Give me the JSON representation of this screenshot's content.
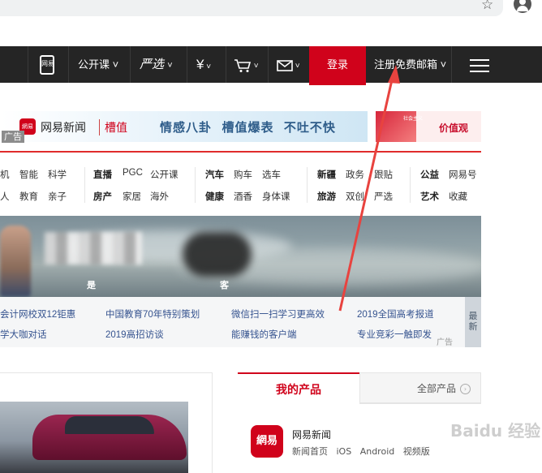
{
  "browser": {
    "star_icon": "star-icon",
    "profile_icon": "account-circle-icon"
  },
  "nav": {
    "items": [
      {
        "label": "",
        "icon": "phone-icon",
        "sub": "网易"
      },
      {
        "label": "公开课"
      },
      {
        "label": "严选"
      },
      {
        "label": "¥"
      },
      {
        "label": "cart"
      },
      {
        "label": "mail"
      }
    ],
    "login": "登录",
    "register": "注册免费邮箱",
    "menu_icon": "hamburger-icon"
  },
  "banner": {
    "logo_text": "网易新闻",
    "brand_tag": "槽值",
    "slogan": "情感八卦  槽值爆表  不吐不快",
    "ad_label": "广告",
    "right_small": "社会主义",
    "right_text": "价值观"
  },
  "nav_links": {
    "row1": [
      "机",
      "智能",
      "科学",
      "直播",
      "PGC",
      "公开课",
      "汽车",
      "购车",
      "选车",
      "新疆",
      "政务",
      "跟贴",
      "公益",
      "网易号"
    ],
    "row2": [
      "人",
      "教育",
      "亲子",
      "房产",
      "家居",
      "海外",
      "健康",
      "酒香",
      "身体课",
      "旅游",
      "双创",
      "严选",
      "艺术",
      "收藏"
    ]
  },
  "hero": {
    "caption_a": "是",
    "caption_b": "客"
  },
  "headline_links": {
    "row1": [
      "会计网校双12钜惠",
      "中国教育70年特别策划",
      "微信扫一扫学习更高效",
      "2019全国高考报道"
    ],
    "row2": [
      "学大咖对话",
      "2019高招访谈",
      "能赚钱的客户端",
      "专业竞彩一触即发"
    ],
    "latest": "最新",
    "ad": "广告"
  },
  "products": {
    "tab_active": "我的产品",
    "tab_all": "全部产品",
    "app_icon_text": "網易",
    "app_name": "网易新闻",
    "app_links": [
      "新闻首页",
      "iOS",
      "Android",
      "视频版"
    ]
  },
  "watermark": "Baidu 经验",
  "colors": {
    "accent": "#d0021b",
    "nav_bg": "#252525",
    "arrow": "#e8433f"
  }
}
